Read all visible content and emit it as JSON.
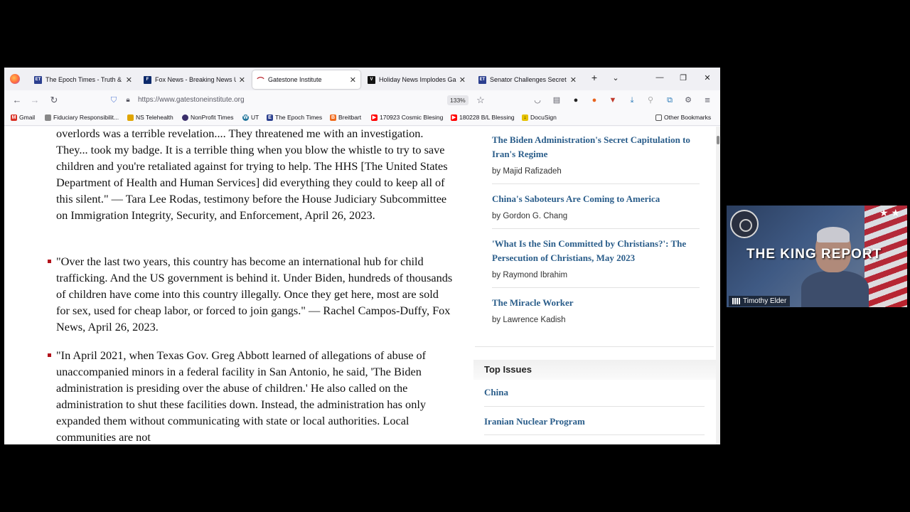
{
  "tabs": [
    {
      "label": "The Epoch Times - Truth & Tr",
      "icon": "epoch-times-favicon",
      "color": "#2b3f8f",
      "active": false
    },
    {
      "label": "Fox News - Breaking News Up",
      "icon": "fox-news-favicon",
      "color": "#0d2a6b",
      "active": false
    },
    {
      "label": "Gatestone Institute",
      "icon": "gatestone-favicon",
      "color": "#b3121b",
      "active": true
    },
    {
      "label": "Holiday News Implodes Garla",
      "icon": "v-favicon",
      "color": "#111111",
      "active": false
    },
    {
      "label": "Senator Challenges Secret Se",
      "icon": "epoch-times-favicon",
      "color": "#2b3f8f",
      "active": false
    }
  ],
  "navbar": {
    "url": "https://www.gatestoneinstitute.org",
    "zoom": "133%"
  },
  "bookmarks": [
    {
      "label": "Gmail",
      "icon": "gmail-icon",
      "color": "#d93025"
    },
    {
      "label": "Fiduciary Responsibilit...",
      "icon": "cloud-icon",
      "color": "#888888"
    },
    {
      "label": "NS Telehealth",
      "icon": "folder-icon",
      "color": "#e0a500"
    },
    {
      "label": "NonProfit Times",
      "icon": "globe-icon",
      "color": "#3a2e6b"
    },
    {
      "label": "UT",
      "icon": "wordpress-icon",
      "color": "#21759b"
    },
    {
      "label": "The Epoch Times",
      "icon": "epoch-times-icon",
      "color": "#2b3f8f"
    },
    {
      "label": "Breitbart",
      "icon": "breitbart-icon",
      "color": "#f06b1e"
    },
    {
      "label": "170923 Cosmic Blesing",
      "icon": "youtube-icon",
      "color": "#ff0000"
    },
    {
      "label": "180228 B/L Blessing",
      "icon": "youtube-icon",
      "color": "#ff0000"
    },
    {
      "label": "DocuSign",
      "icon": "docusign-icon",
      "color": "#e6c200"
    }
  ],
  "other_bookmarks": "Other Bookmarks",
  "article": {
    "paragraphs": [
      "overlords was a terrible revelation.... They threatened me with an investigation. They... took my badge. It is a terrible thing when you blow the whistle to try to save children and you're retaliated against for trying to help. The HHS [The United States Department of Health and Human Services] did everything they could to keep all of this silent.\" — Tara Lee Rodas, testimony before the House Judiciary Subcommittee on Immigration Integrity, Security, and Enforcement, April 26, 2023.",
      "\"Over the last two years, this country has become an international hub for child trafficking. And the US government is behind it. Under Biden, hundreds of thousands of children have come into this country illegally. Once they get here, most are sold for sex, used for cheap labor, or forced to join gangs.\" — Rachel Campos-Duffy, Fox News, April 26, 2023.",
      "\"In April 2021, when Texas Gov. Greg Abbott learned of allegations of abuse of unaccompanied minors in a federal facility in San Antonio, he said, 'The Biden administration is presiding over the abuse of children.' He also called on the administration to shut these facilities down. Instead, the administration has only expanded them without communicating with state or local authorities. Local communities are not"
    ]
  },
  "sidebar": {
    "articles": [
      {
        "title": "The Biden Administration's Secret Capitulation to Iran's Regime",
        "author": "by Majid Rafizadeh"
      },
      {
        "title": "China's Saboteurs Are Coming to America",
        "author": "by Gordon G. Chang"
      },
      {
        "title": "'What Is the Sin Committed by Christians?': The Persecution of Christians, May 2023",
        "author": "by Raymond Ibrahim"
      },
      {
        "title": "The Miracle Worker",
        "author": "by Lawrence Kadish"
      }
    ],
    "top_issues_heading": "Top Issues",
    "top_issues": [
      "China",
      "Iranian Nuclear Program"
    ]
  },
  "webcam": {
    "title": "THE KING REPORT",
    "name": "Timothy Elder"
  }
}
